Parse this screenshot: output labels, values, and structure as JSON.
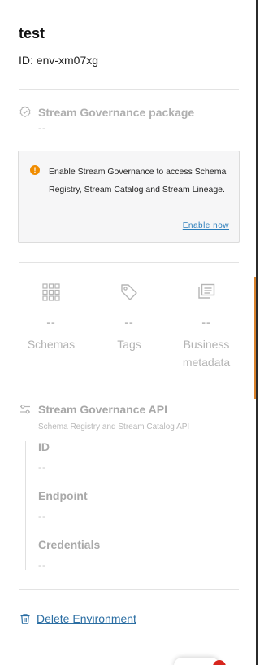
{
  "environment": {
    "name": "test",
    "id_text": "ID: env-xm07xg"
  },
  "package": {
    "title": "Stream Governance package",
    "value": "--",
    "icon": "check-badge-icon"
  },
  "notice": {
    "icon": "warning-circle-icon",
    "text": "Enable Stream Governance to access Schema Registry, Stream Catalog and Stream Lineage.",
    "link_label": "Enable now"
  },
  "stats": [
    {
      "icon": "grid-icon",
      "value": "--",
      "label": "Schemas"
    },
    {
      "icon": "tag-icon",
      "value": "--",
      "label": "Tags"
    },
    {
      "icon": "stacked-documents-icon",
      "value": "--",
      "label": "Business metadata"
    }
  ],
  "api": {
    "icon": "sliders-icon",
    "title": "Stream Governance API",
    "subtitle": "Schema Registry and Stream Catalog API",
    "fields": [
      {
        "label": "ID",
        "value": "--"
      },
      {
        "label": "Endpoint",
        "value": "--"
      },
      {
        "label": "Credentials",
        "value": "--"
      }
    ]
  },
  "delete": {
    "icon": "trash-icon",
    "label": "Delete Environment"
  },
  "colors": {
    "link": "#2b6ea3",
    "warning": "#f08c00",
    "muted": "#b5b5b5",
    "notice_bg": "#f6f6f7"
  }
}
